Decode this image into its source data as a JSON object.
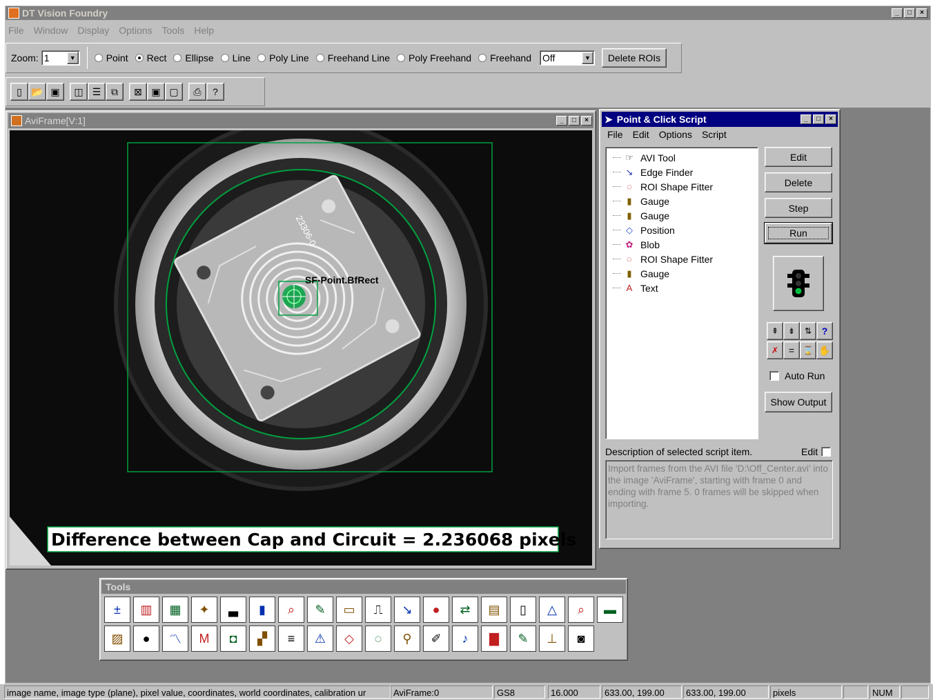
{
  "app": {
    "title": "DT Vision Foundry"
  },
  "menu": [
    "File",
    "Window",
    "Display",
    "Options",
    "Tools",
    "Help"
  ],
  "toolbar": {
    "zoom_label": "Zoom:",
    "zoom_value": "1",
    "roi_types": [
      {
        "label": "Point",
        "selected": false
      },
      {
        "label": "Rect",
        "selected": true
      },
      {
        "label": "Ellipse",
        "selected": false
      },
      {
        "label": "Line",
        "selected": false
      },
      {
        "label": "Poly Line",
        "selected": false
      },
      {
        "label": "Freehand Line",
        "selected": false
      },
      {
        "label": "Poly Freehand",
        "selected": false
      },
      {
        "label": "Freehand",
        "selected": false
      }
    ],
    "mode_value": "Off",
    "delete_rois": "Delete ROIs"
  },
  "image_window": {
    "title": "AviFrame[V:1]",
    "overlay_label": "SF-Point.BfRect",
    "result_text": "Difference between Cap and Circuit = 2.236068 pixels",
    "circuit_text": "23306-0"
  },
  "script_window": {
    "title": "Point & Click Script",
    "menu": [
      "File",
      "Edit",
      "Options",
      "Script"
    ],
    "items": [
      {
        "label": "AVI Tool",
        "icon": "hand-pointer-icon"
      },
      {
        "label": "Edge Finder",
        "icon": "edge-finder-icon"
      },
      {
        "label": "ROI Shape Fitter",
        "icon": "roi-shape-fitter-icon"
      },
      {
        "label": "Gauge",
        "icon": "gauge-icon"
      },
      {
        "label": "Gauge",
        "icon": "gauge-icon"
      },
      {
        "label": "Position",
        "icon": "position-icon"
      },
      {
        "label": "Blob",
        "icon": "blob-icon"
      },
      {
        "label": "ROI Shape Fitter",
        "icon": "roi-shape-fitter-icon"
      },
      {
        "label": "Gauge",
        "icon": "gauge-icon"
      },
      {
        "label": "Text",
        "icon": "text-icon"
      }
    ],
    "buttons": {
      "edit": "Edit",
      "delete": "Delete",
      "step": "Step",
      "run": "Run",
      "show_output": "Show Output"
    },
    "auto_run": "Auto Run",
    "desc_label": "Description of selected script item.",
    "desc_edit": "Edit",
    "description": "Import frames from the AVI file 'D:\\Off_Center.avi' into the image 'AviFrame', starting with frame 0 and ending with frame 5. 0 frames will be skipped when importing."
  },
  "tools_panel": {
    "title": "Tools"
  },
  "status": {
    "hint": "image name, image type (plane), pixel value, coordinates, world coordinates, calibration ur",
    "image_name": "AviFrame:0",
    "image_type": "GS8",
    "pixel_value": "16.000",
    "coords": "633.00, 199.00",
    "world_coords": "633.00, 199.00",
    "units": "pixels",
    "num": "NUM"
  },
  "colors": {
    "desktop": "#808080",
    "face": "#c0c0c0",
    "overlay_green": "#00a040",
    "title_active": "#000080"
  }
}
